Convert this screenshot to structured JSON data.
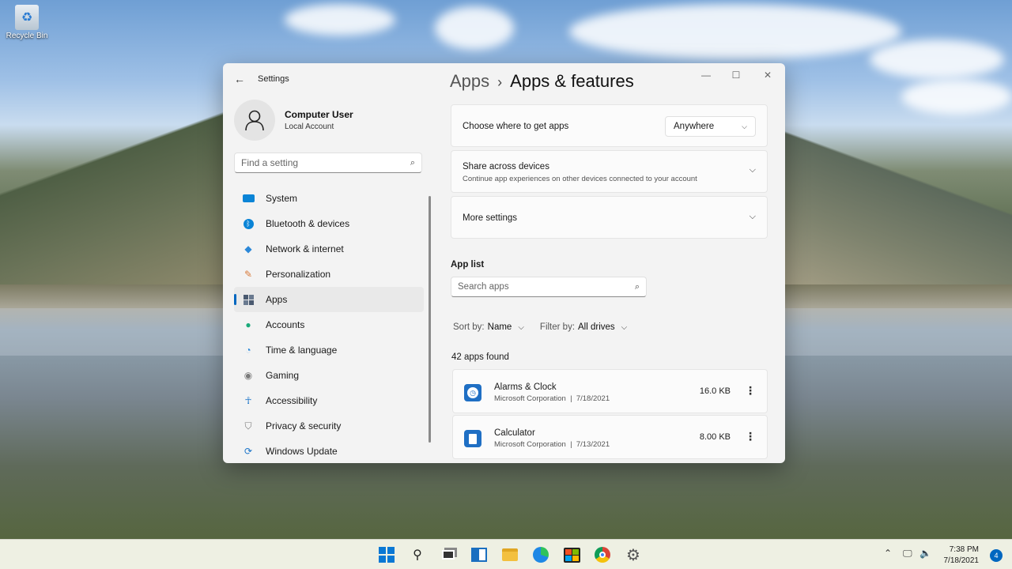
{
  "desktop": {
    "recycle_bin_label": "Recycle Bin"
  },
  "window": {
    "app_title": "Settings",
    "controls": {
      "minimize": "—",
      "maximize": "☐",
      "close": "✕"
    }
  },
  "profile": {
    "name": "Computer User",
    "account_type": "Local Account"
  },
  "find": {
    "placeholder": "Find a setting"
  },
  "sidebar": {
    "items": [
      {
        "label": "System",
        "icon": "monitor-icon",
        "color": "#0a84d6"
      },
      {
        "label": "Bluetooth & devices",
        "icon": "bluetooth-icon",
        "color": "#0a84d6"
      },
      {
        "label": "Network & internet",
        "icon": "wifi-icon",
        "color": "#2b88d8"
      },
      {
        "label": "Personalization",
        "icon": "brush-icon",
        "color": "#d87a3a"
      },
      {
        "label": "Apps",
        "icon": "apps-icon",
        "color": "#4a5a70",
        "active": true
      },
      {
        "label": "Accounts",
        "icon": "person-icon",
        "color": "#1aaa7a"
      },
      {
        "label": "Time & language",
        "icon": "globe-clock-icon",
        "color": "#2b88d8"
      },
      {
        "label": "Gaming",
        "icon": "controller-icon",
        "color": "#7a7a7a"
      },
      {
        "label": "Accessibility",
        "icon": "accessibility-icon",
        "color": "#1a73c8"
      },
      {
        "label": "Privacy & security",
        "icon": "shield-icon",
        "color": "#7a7a7a"
      },
      {
        "label": "Windows Update",
        "icon": "update-icon",
        "color": "#1a73c8"
      }
    ]
  },
  "breadcrumb": {
    "parent": "Apps",
    "separator": "›",
    "current": "Apps & features"
  },
  "cards": {
    "get_apps": {
      "title": "Choose where to get apps",
      "value": "Anywhere"
    },
    "share": {
      "title": "Share across devices",
      "subtitle": "Continue app experiences on other devices connected to your account"
    },
    "more": {
      "title": "More settings"
    }
  },
  "app_list": {
    "heading": "App list",
    "search_placeholder": "Search apps",
    "sort_label": "Sort by:",
    "sort_value": "Name",
    "filter_label": "Filter by:",
    "filter_value": "All drives",
    "count_text": "42 apps found",
    "apps": [
      {
        "name": "Alarms & Clock",
        "publisher": "Microsoft Corporation",
        "date": "7/18/2021",
        "size": "16.0 KB",
        "icon": "clock-icon",
        "color": "#1f6fc4"
      },
      {
        "name": "Calculator",
        "publisher": "Microsoft Corporation",
        "date": "7/13/2021",
        "size": "8.00 KB",
        "icon": "calculator-icon",
        "color": "#1f6fc4"
      }
    ]
  },
  "taskbar": {
    "time": "7:38 PM",
    "date": "7/18/2021",
    "notification_count": "4",
    "icons": [
      "windows-start-icon",
      "search-icon",
      "task-view-icon",
      "widgets-icon",
      "file-explorer-icon",
      "edge-icon",
      "store-icon",
      "chrome-icon",
      "settings-icon"
    ]
  }
}
